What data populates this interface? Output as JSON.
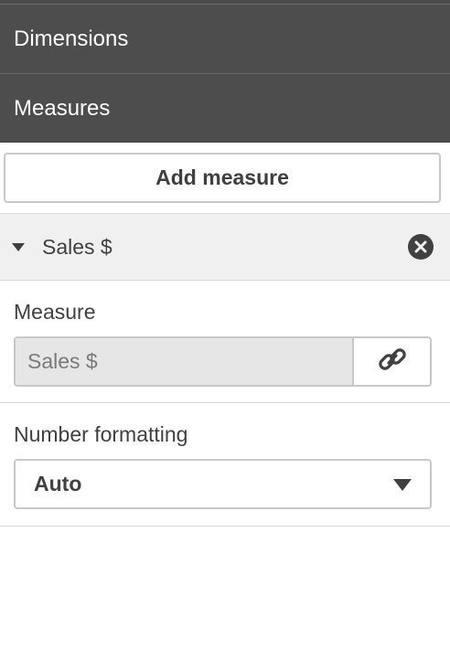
{
  "panel": {
    "dimensions_label": "Dimensions",
    "measures_label": "Measures",
    "add_measure_label": "Add measure"
  },
  "measure_item": {
    "title": "Sales $",
    "field_label": "Measure",
    "field_value": "Sales $",
    "number_formatting_label": "Number formatting",
    "number_formatting_value": "Auto"
  }
}
